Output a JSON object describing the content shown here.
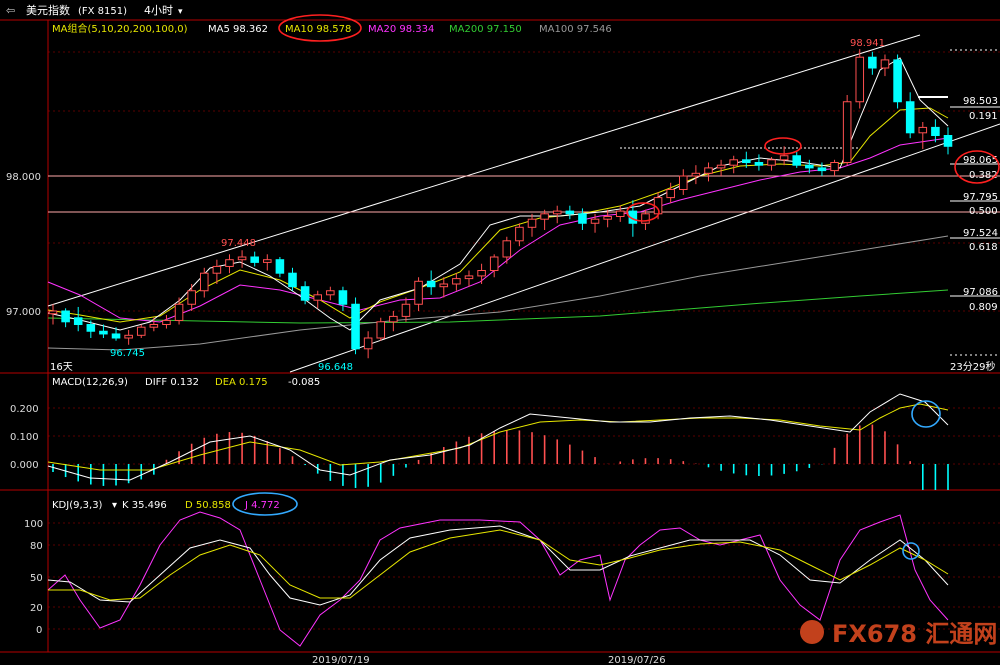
{
  "header": {
    "symbol": "美元指数",
    "code": "(FX 8151)",
    "period": "4小时"
  },
  "ma_header": {
    "label": "MA组合(5,10,20,200,100,0)",
    "items": [
      {
        "text": "MA5 98.362",
        "color": "#ffffff"
      },
      {
        "text": "MA10 98.578",
        "color": "#e6e600"
      },
      {
        "text": "MA20 98.334",
        "color": "#ff33ff"
      },
      {
        "text": "MA200 97.150",
        "color": "#33cc33"
      },
      {
        "text": "MA100 97.546",
        "color": "#999999"
      }
    ]
  },
  "macd_header": {
    "label": "MACD(12,26,9)",
    "diff": "DIFF 0.132",
    "dea": "DEA 0.175",
    "macd": "-0.085"
  },
  "kdj_header": {
    "label": "KDJ(9,3,3)",
    "k": "K 35.496",
    "d": "D 50.858",
    "j": "J 4.772"
  },
  "dates": [
    "2019/07/19",
    "2019/07/26"
  ],
  "footer": {
    "days": "16天",
    "countdown": "23分29秒"
  },
  "watermark": "FX678 汇通网",
  "colors": {
    "up": "#ff5050",
    "down": "#00ffff",
    "ma5": "#ffffff",
    "ma10": "#e6e600",
    "ma20": "#ff33ff",
    "ma100": "#999999",
    "ma200": "#33cc33",
    "circle": "#ff2020",
    "blue_circle": "#33aaff"
  },
  "chart_data": [
    {
      "type": "candlestick",
      "title": "美元指数 (FX 8151) 4小时",
      "y_ticks": [
        "98.000",
        "97.000"
      ],
      "ylim": [
        96.45,
        99.05
      ],
      "annotations": {
        "high": "98.941",
        "mid_high": "97.448",
        "low1": "96.745",
        "low2": "96.648"
      },
      "fib_levels": [
        {
          "price": "98.503",
          "ratio": "0.191"
        },
        {
          "price": "98.065",
          "ratio": "0.382"
        },
        {
          "price": "97.795",
          "ratio": "0.500"
        },
        {
          "price": "97.524",
          "ratio": "0.618"
        },
        {
          "price": "97.086",
          "ratio": "0.809"
        }
      ],
      "candles": [
        [
          96.98,
          97.05,
          96.9,
          97.0
        ],
        [
          97.0,
          97.02,
          96.88,
          96.92
        ],
        [
          96.95,
          97.03,
          96.85,
          96.9
        ],
        [
          96.9,
          96.93,
          96.8,
          96.85
        ],
        [
          96.85,
          96.9,
          96.8,
          96.83
        ],
        [
          96.83,
          96.88,
          96.78,
          96.8
        ],
        [
          96.8,
          96.86,
          96.75,
          96.82
        ],
        [
          96.82,
          96.9,
          96.8,
          96.88
        ],
        [
          96.88,
          96.95,
          96.85,
          96.9
        ],
        [
          96.9,
          96.97,
          96.87,
          96.93
        ],
        [
          96.93,
          97.1,
          96.9,
          97.05
        ],
        [
          97.05,
          97.2,
          97.0,
          97.15
        ],
        [
          97.15,
          97.32,
          97.1,
          97.28
        ],
        [
          97.28,
          97.38,
          97.2,
          97.33
        ],
        [
          97.33,
          97.42,
          97.28,
          97.38
        ],
        [
          97.38,
          97.45,
          97.32,
          97.4
        ],
        [
          97.4,
          97.44,
          97.33,
          97.36
        ],
        [
          97.36,
          97.42,
          97.3,
          97.38
        ],
        [
          97.38,
          97.4,
          97.25,
          97.28
        ],
        [
          97.28,
          97.32,
          97.15,
          97.18
        ],
        [
          97.18,
          97.22,
          97.05,
          97.08
        ],
        [
          97.08,
          97.15,
          97.02,
          97.12
        ],
        [
          97.12,
          97.18,
          97.08,
          97.15
        ],
        [
          97.15,
          97.18,
          97.0,
          97.05
        ],
        [
          97.05,
          97.1,
          96.68,
          96.72
        ],
        [
          96.72,
          96.85,
          96.65,
          96.8
        ],
        [
          96.8,
          96.95,
          96.78,
          96.92
        ],
        [
          96.92,
          97.0,
          96.85,
          96.96
        ],
        [
          96.96,
          97.1,
          96.92,
          97.05
        ],
        [
          97.05,
          97.25,
          97.0,
          97.22
        ],
        [
          97.22,
          97.3,
          97.12,
          97.18
        ],
        [
          97.18,
          97.25,
          97.1,
          97.2
        ],
        [
          97.2,
          97.28,
          97.15,
          97.24
        ],
        [
          97.24,
          97.3,
          97.18,
          97.26
        ],
        [
          97.26,
          97.35,
          97.2,
          97.3
        ],
        [
          97.3,
          97.42,
          97.25,
          97.4
        ],
        [
          97.4,
          97.55,
          97.35,
          97.52
        ],
        [
          97.52,
          97.65,
          97.48,
          97.62
        ],
        [
          97.62,
          97.72,
          97.55,
          97.68
        ],
        [
          97.68,
          97.75,
          97.6,
          97.72
        ],
        [
          97.72,
          97.78,
          97.65,
          97.74
        ],
        [
          97.74,
          97.78,
          97.68,
          97.72
        ],
        [
          97.72,
          97.76,
          97.6,
          97.65
        ],
        [
          97.65,
          97.72,
          97.58,
          97.68
        ],
        [
          97.68,
          97.75,
          97.62,
          97.7
        ],
        [
          97.7,
          97.78,
          97.66,
          97.74
        ],
        [
          97.74,
          97.82,
          97.55,
          97.65
        ],
        [
          97.65,
          97.75,
          97.6,
          97.72
        ],
        [
          97.72,
          97.88,
          97.68,
          97.84
        ],
        [
          97.84,
          97.95,
          97.8,
          97.9
        ],
        [
          97.9,
          98.05,
          97.86,
          98.0
        ],
        [
          98.0,
          98.08,
          97.94,
          98.02
        ],
        [
          98.02,
          98.1,
          97.96,
          98.06
        ],
        [
          98.06,
          98.12,
          98.0,
          98.08
        ],
        [
          98.08,
          98.15,
          98.02,
          98.12
        ],
        [
          98.12,
          98.18,
          98.06,
          98.1
        ],
        [
          98.1,
          98.16,
          98.04,
          98.08
        ],
        [
          98.08,
          98.14,
          98.04,
          98.12
        ],
        [
          98.12,
          98.22,
          98.08,
          98.15
        ],
        [
          98.15,
          98.18,
          98.06,
          98.08
        ],
        [
          98.08,
          98.12,
          98.02,
          98.06
        ],
        [
          98.06,
          98.1,
          98.0,
          98.04
        ],
        [
          98.04,
          98.12,
          98.0,
          98.1
        ],
        [
          98.1,
          98.6,
          98.08,
          98.55
        ],
        [
          98.55,
          98.94,
          98.5,
          98.88
        ],
        [
          98.88,
          98.92,
          98.75,
          98.8
        ],
        [
          98.8,
          98.9,
          98.74,
          98.86
        ],
        [
          98.86,
          98.9,
          98.5,
          98.55
        ],
        [
          98.55,
          98.62,
          98.28,
          98.32
        ],
        [
          98.32,
          98.4,
          98.2,
          98.36
        ],
        [
          98.36,
          98.42,
          98.25,
          98.3
        ],
        [
          98.3,
          98.36,
          98.16,
          98.22
        ]
      ]
    },
    {
      "type": "bar",
      "title": "MACD(12,26,9)",
      "y_ticks": [
        "0.200",
        "0.100",
        "0.000"
      ],
      "ylim": [
        -0.11,
        0.26
      ]
    },
    {
      "type": "line",
      "title": "KDJ(9,3,3)",
      "y_ticks": [
        "100",
        "80",
        "50",
        "20",
        "0"
      ],
      "ylim": [
        -10,
        110
      ]
    }
  ]
}
